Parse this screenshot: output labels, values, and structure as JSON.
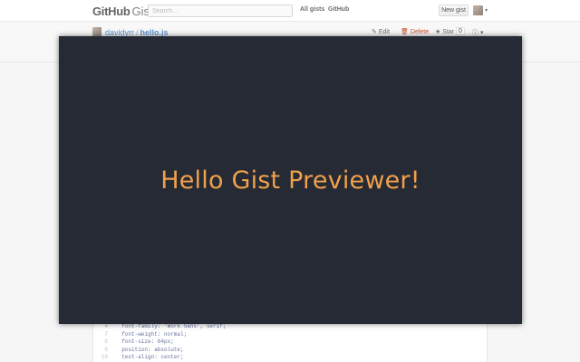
{
  "header": {
    "logo_github": "GitHub",
    "logo_gist": "Gist",
    "search_placeholder": "Search...",
    "nav": [
      "All gists",
      "GitHub"
    ],
    "new_gist_label": "New gist"
  },
  "gist": {
    "owner": "davidyrr",
    "separator": "/",
    "filename": "hello.js",
    "actions": {
      "edit": "Edit",
      "delete": "Delete",
      "star": "Star",
      "star_count": "0"
    }
  },
  "code": {
    "lines": [
      {
        "n": "4",
        "text": "  font-family: 'Work Sans', serif;"
      },
      {
        "n": "7",
        "text": "  font-weight: normal;"
      },
      {
        "n": "8",
        "text": "  font-size: 64px;"
      },
      {
        "n": "9",
        "text": "  position: absolute;"
      },
      {
        "n": "10",
        "text": "  text-align: center;"
      }
    ]
  },
  "preview": {
    "message": "Hello Gist Previewer!",
    "background": "#262a34",
    "text_color": "#f0a04b"
  },
  "icons": {
    "edit": "pencil-icon",
    "delete": "trash-icon",
    "star": "star-icon",
    "embed": "info-icon",
    "menu": "caret-down-icon"
  }
}
